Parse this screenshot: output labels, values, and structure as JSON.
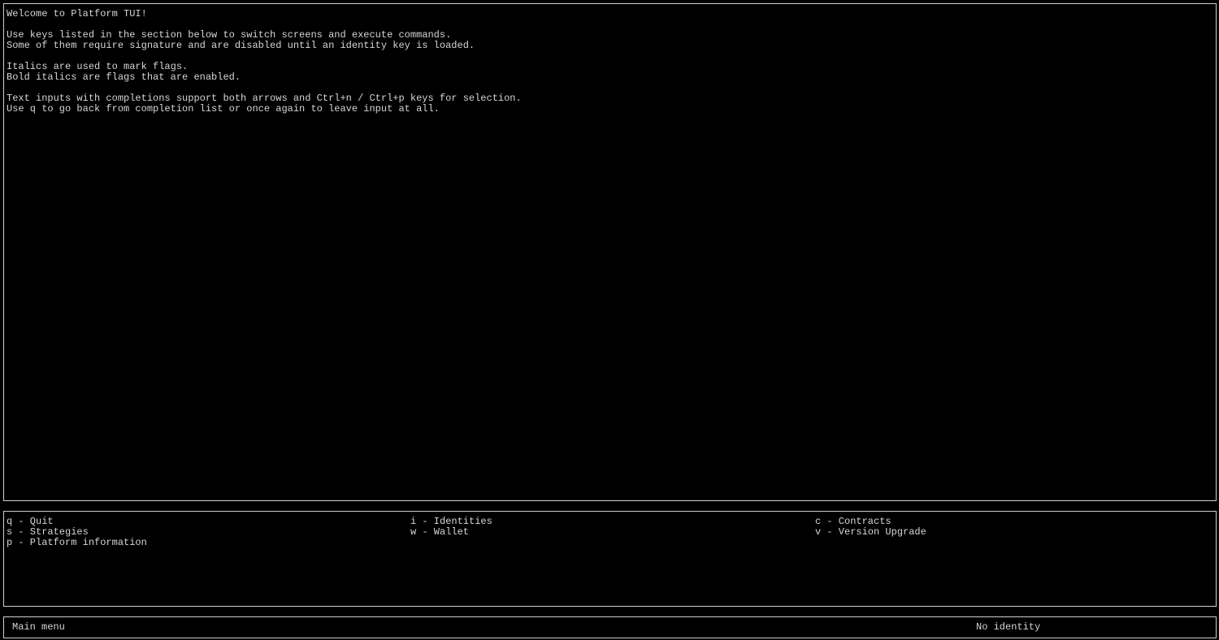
{
  "welcome": {
    "lines": [
      "Welcome to Platform TUI!",
      "Use keys listed in the section below to switch screens and execute commands.",
      "Some of them require signature and are disabled until an identity key is loaded.",
      "Italics are used to mark flags.",
      "Bold italics are flags that are enabled.",
      "Text inputs with completions support both arrows and Ctrl+n / Ctrl+p keys for selection.",
      "Use q to go back from completion list or once again to leave input at all."
    ]
  },
  "keys": {
    "col1": [
      "q - Quit",
      "s - Strategies",
      "p - Platform information"
    ],
    "col2": [
      "i - Identities",
      "w - Wallet"
    ],
    "col3": [
      "c - Contracts",
      "v - Version Upgrade"
    ]
  },
  "status": {
    "screen": "Main menu",
    "identity": "No identity"
  },
  "colors": {
    "background": "#000000",
    "text": "#d6d6d6",
    "border": "#cfcfcf"
  }
}
